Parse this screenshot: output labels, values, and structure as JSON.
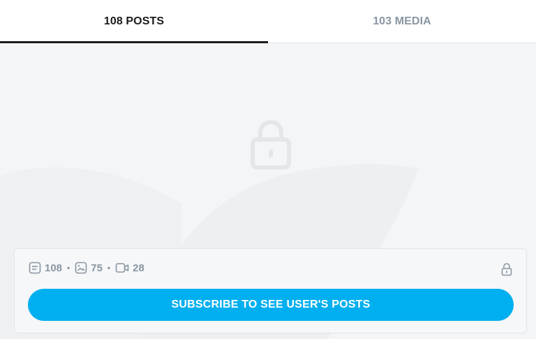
{
  "tabs": [
    {
      "label": "108 POSTS",
      "active": true
    },
    {
      "label": "103 MEDIA",
      "active": false
    }
  ],
  "locked_content": {
    "icon": "lock-icon",
    "stats": {
      "posts": "108",
      "images": "75",
      "videos": "28",
      "separator": "•"
    },
    "lock_icon": "lock-icon",
    "subscribe_label": "SUBSCRIBE TO SEE USER'S POSTS"
  },
  "colors": {
    "accent": "#00aff0",
    "active_tab": "#1b1b1b",
    "inactive_tab": "#8a96a3",
    "panel_bg": "#f4f5f6"
  }
}
